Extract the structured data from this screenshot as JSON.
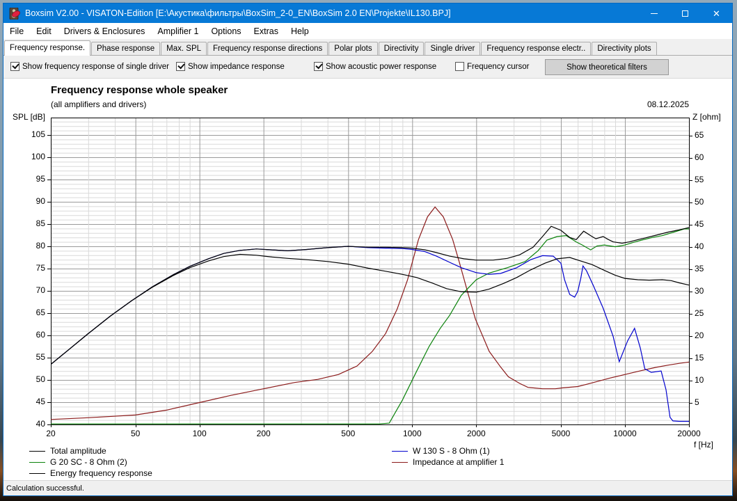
{
  "window": {
    "title": "Boxsim V2.00 - VISATON-Edition [E:\\Акустика\\фильтры\\BoxSim_2-0_EN\\BoxSim 2.0 EN\\Projekte\\IL130.BPJ]",
    "accent_color": "#0779d6"
  },
  "menu": {
    "items": [
      "File",
      "Edit",
      "Drivers & Enclosures",
      "Amplifier 1",
      "Options",
      "Extras",
      "Help"
    ]
  },
  "tabs": {
    "active_index": 0,
    "items": [
      "Frequency response.",
      "Phase response",
      "Max. SPL",
      "Frequency response directions",
      "Polar plots",
      "Directivity",
      "Single driver",
      "Frequency response electr..",
      "Directivity plots"
    ]
  },
  "options": {
    "checkboxes": [
      {
        "label": "Show frequency response of single driver",
        "checked": true
      },
      {
        "label": "Show impedance response",
        "checked": true
      },
      {
        "label": "Show acoustic power response",
        "checked": true
      },
      {
        "label": "Frequency cursor",
        "checked": false
      }
    ],
    "button_label": "Show theoretical filters"
  },
  "chart": {
    "title": "Frequency response whole speaker",
    "subtitle": "(all amplifiers and drivers)",
    "date": "08.12.2025",
    "y_left_title": "SPL [dB]",
    "y_right_title": "Z [ohm]",
    "x_axis_title": "f [Hz]"
  },
  "chart_data": {
    "type": "line",
    "x_axis": {
      "scale": "log",
      "min": 20,
      "max": 20000,
      "ticks": [
        20,
        50,
        100,
        200,
        500,
        1000,
        2000,
        5000,
        10000,
        20000
      ],
      "label": "f [Hz]"
    },
    "y_left_axis": {
      "label": "SPL [dB]",
      "min": 40,
      "max": 109,
      "ticks": [
        105,
        100,
        95,
        90,
        85,
        80,
        75,
        70,
        65,
        60,
        55,
        50,
        45,
        40
      ],
      "grid_step_minor": 1,
      "grid_step_major": 5
    },
    "y_right_axis": {
      "label": "Z [ohm]",
      "min": 0,
      "max": 69,
      "ticks": [
        65,
        60,
        55,
        50,
        45,
        40,
        35,
        30,
        25,
        20,
        15,
        10,
        5
      ]
    },
    "grid": true,
    "series": [
      {
        "name": "Impedance at amplifier 1",
        "axis": "z",
        "color": "#8b1a1a",
        "points": [
          [
            20,
            1.2
          ],
          [
            30,
            1.6
          ],
          [
            50,
            2.2
          ],
          [
            70,
            3.3
          ],
          [
            100,
            5.0
          ],
          [
            140,
            6.6
          ],
          [
            200,
            8.1
          ],
          [
            280,
            9.5
          ],
          [
            360,
            10.2
          ],
          [
            450,
            11.3
          ],
          [
            550,
            13.2
          ],
          [
            650,
            16.5
          ],
          [
            750,
            20.5
          ],
          [
            850,
            26.0
          ],
          [
            950,
            32.5
          ],
          [
            1070,
            41.6
          ],
          [
            1180,
            46.7
          ],
          [
            1280,
            48.9
          ],
          [
            1400,
            46.7
          ],
          [
            1550,
            41.6
          ],
          [
            1670,
            36.3
          ],
          [
            1830,
            29.5
          ],
          [
            1980,
            23.8
          ],
          [
            2300,
            16.5
          ],
          [
            2600,
            13.0
          ],
          [
            2830,
            10.8
          ],
          [
            3200,
            9.3
          ],
          [
            3500,
            8.4
          ],
          [
            4100,
            8.1
          ],
          [
            4700,
            8.1
          ],
          [
            5100,
            8.3
          ],
          [
            6000,
            8.6
          ],
          [
            6600,
            9.1
          ],
          [
            7500,
            9.8
          ],
          [
            8500,
            10.5
          ],
          [
            10000,
            11.3
          ],
          [
            12000,
            12.2
          ],
          [
            14000,
            12.9
          ],
          [
            16000,
            13.4
          ],
          [
            18000,
            13.8
          ],
          [
            20000,
            14.1
          ]
        ]
      },
      {
        "name": "G 20 SC - 8 Ohm (2)",
        "axis": "spl",
        "color": "#0a820a",
        "points": [
          [
            20,
            40.1
          ],
          [
            100,
            40.1
          ],
          [
            300,
            40.1
          ],
          [
            500,
            40.1
          ],
          [
            700,
            40.1
          ],
          [
            780,
            40.3
          ],
          [
            900,
            45.5
          ],
          [
            1050,
            52.0
          ],
          [
            1200,
            57.5
          ],
          [
            1350,
            61.5
          ],
          [
            1500,
            64.5
          ],
          [
            1700,
            69.0
          ],
          [
            2000,
            72.5
          ],
          [
            2300,
            74.0
          ],
          [
            2800,
            75.2
          ],
          [
            3400,
            76.6
          ],
          [
            3900,
            79.0
          ],
          [
            4300,
            81.4
          ],
          [
            4800,
            82.2
          ],
          [
            5300,
            82.4
          ],
          [
            5900,
            81.0
          ],
          [
            6300,
            80.3
          ],
          [
            6900,
            79.2
          ],
          [
            7400,
            80.1
          ],
          [
            8000,
            80.3
          ],
          [
            9000,
            79.9
          ],
          [
            10000,
            80.3
          ],
          [
            11000,
            80.9
          ],
          [
            12000,
            81.4
          ],
          [
            13500,
            82.0
          ],
          [
            15000,
            82.4
          ],
          [
            17000,
            83.2
          ],
          [
            19000,
            83.9
          ],
          [
            20000,
            83.9
          ]
        ]
      },
      {
        "name": "W 130 S - 8 Ohm (1)",
        "axis": "spl",
        "color": "#0000cd",
        "points": [
          [
            20,
            53.5
          ],
          [
            24,
            56.6
          ],
          [
            30,
            60.4
          ],
          [
            38,
            64.3
          ],
          [
            48,
            67.8
          ],
          [
            60,
            70.9
          ],
          [
            75,
            73.6
          ],
          [
            90,
            75.5
          ],
          [
            110,
            77.2
          ],
          [
            130,
            78.4
          ],
          [
            155,
            79.1
          ],
          [
            185,
            79.4
          ],
          [
            220,
            79.2
          ],
          [
            260,
            79.0
          ],
          [
            320,
            79.3
          ],
          [
            400,
            79.7
          ],
          [
            500,
            80.0
          ],
          [
            620,
            79.7
          ],
          [
            750,
            79.6
          ],
          [
            900,
            79.5
          ],
          [
            1000,
            79.3
          ],
          [
            1150,
            78.8
          ],
          [
            1300,
            77.8
          ],
          [
            1500,
            76.4
          ],
          [
            1700,
            75.2
          ],
          [
            2000,
            74.1
          ],
          [
            2300,
            73.7
          ],
          [
            2600,
            73.9
          ],
          [
            3100,
            75.2
          ],
          [
            3600,
            77.0
          ],
          [
            4100,
            77.9
          ],
          [
            4600,
            77.8
          ],
          [
            5000,
            76.2
          ],
          [
            5200,
            72.5
          ],
          [
            5500,
            69.2
          ],
          [
            5800,
            68.6
          ],
          [
            6000,
            69.9
          ],
          [
            6200,
            72.8
          ],
          [
            6350,
            75.6
          ],
          [
            6600,
            74.5
          ],
          [
            7100,
            71.2
          ],
          [
            7900,
            66.1
          ],
          [
            8800,
            59.8
          ],
          [
            9400,
            54.1
          ],
          [
            10300,
            58.8
          ],
          [
            11100,
            61.6
          ],
          [
            11800,
            57.2
          ],
          [
            12400,
            52.5
          ],
          [
            13300,
            51.7
          ],
          [
            14800,
            52.0
          ],
          [
            15600,
            47.8
          ],
          [
            16300,
            41.6
          ],
          [
            16800,
            40.8
          ],
          [
            18000,
            40.7
          ],
          [
            20000,
            40.7
          ]
        ]
      },
      {
        "name": "Energy frequency response",
        "axis": "spl",
        "color": "#000000",
        "points": [
          [
            20,
            53.5
          ],
          [
            24,
            56.6
          ],
          [
            30,
            60.4
          ],
          [
            38,
            64.3
          ],
          [
            48,
            67.8
          ],
          [
            60,
            70.8
          ],
          [
            75,
            73.4
          ],
          [
            90,
            75.2
          ],
          [
            110,
            76.7
          ],
          [
            130,
            77.7
          ],
          [
            155,
            78.2
          ],
          [
            185,
            78.0
          ],
          [
            220,
            77.6
          ],
          [
            260,
            77.3
          ],
          [
            320,
            77.0
          ],
          [
            400,
            76.6
          ],
          [
            500,
            76.0
          ],
          [
            620,
            75.1
          ],
          [
            750,
            74.4
          ],
          [
            900,
            73.7
          ],
          [
            1050,
            73.0
          ],
          [
            1250,
            71.7
          ],
          [
            1450,
            70.5
          ],
          [
            1700,
            69.8
          ],
          [
            2000,
            69.7
          ],
          [
            2300,
            70.4
          ],
          [
            2700,
            71.7
          ],
          [
            3100,
            73.0
          ],
          [
            3600,
            74.7
          ],
          [
            4200,
            76.2
          ],
          [
            4800,
            77.2
          ],
          [
            5500,
            77.5
          ],
          [
            6300,
            76.6
          ],
          [
            7000,
            75.9
          ],
          [
            8000,
            74.6
          ],
          [
            9000,
            73.5
          ],
          [
            10000,
            72.8
          ],
          [
            11500,
            72.5
          ],
          [
            13000,
            72.4
          ],
          [
            15000,
            72.5
          ],
          [
            16500,
            72.3
          ],
          [
            18000,
            71.8
          ],
          [
            20000,
            71.3
          ]
        ]
      },
      {
        "name": "Total amplitude",
        "axis": "spl",
        "color": "#000000",
        "points": [
          [
            20,
            53.5
          ],
          [
            24,
            56.6
          ],
          [
            30,
            60.4
          ],
          [
            38,
            64.3
          ],
          [
            48,
            67.8
          ],
          [
            60,
            70.9
          ],
          [
            75,
            73.6
          ],
          [
            90,
            75.5
          ],
          [
            110,
            77.2
          ],
          [
            130,
            78.4
          ],
          [
            155,
            79.1
          ],
          [
            185,
            79.4
          ],
          [
            220,
            79.2
          ],
          [
            260,
            79.0
          ],
          [
            320,
            79.3
          ],
          [
            400,
            79.7
          ],
          [
            500,
            80.0
          ],
          [
            620,
            79.8
          ],
          [
            750,
            79.8
          ],
          [
            900,
            79.7
          ],
          [
            1000,
            79.6
          ],
          [
            1150,
            79.2
          ],
          [
            1300,
            78.6
          ],
          [
            1500,
            77.8
          ],
          [
            1750,
            77.2
          ],
          [
            2000,
            76.9
          ],
          [
            2400,
            76.9
          ],
          [
            2800,
            77.3
          ],
          [
            3200,
            78.1
          ],
          [
            3700,
            79.8
          ],
          [
            4100,
            82.2
          ],
          [
            4500,
            84.5
          ],
          [
            5000,
            83.6
          ],
          [
            5500,
            82.0
          ],
          [
            5900,
            81.5
          ],
          [
            6400,
            83.4
          ],
          [
            7000,
            82.2
          ],
          [
            7300,
            81.7
          ],
          [
            7900,
            82.2
          ],
          [
            8300,
            81.6
          ],
          [
            8800,
            81.0
          ],
          [
            9700,
            80.7
          ],
          [
            10500,
            81.0
          ],
          [
            11500,
            81.5
          ],
          [
            12500,
            81.9
          ],
          [
            14000,
            82.5
          ],
          [
            16000,
            83.2
          ],
          [
            18000,
            83.7
          ],
          [
            20000,
            84.2
          ]
        ]
      }
    ],
    "legend": {
      "left": [
        {
          "label": "Total amplitude",
          "color": "#000000"
        },
        {
          "label": "G 20 SC - 8 Ohm (2)",
          "color": "#0a820a"
        },
        {
          "label": "Energy frequency response",
          "color": "#000000"
        }
      ],
      "right": [
        {
          "label": "W 130 S - 8 Ohm (1)",
          "color": "#0000cd"
        },
        {
          "label": "Impedance at amplifier 1",
          "color": "#8b1a1a"
        }
      ]
    }
  },
  "status": {
    "text": "Calculation successful."
  }
}
